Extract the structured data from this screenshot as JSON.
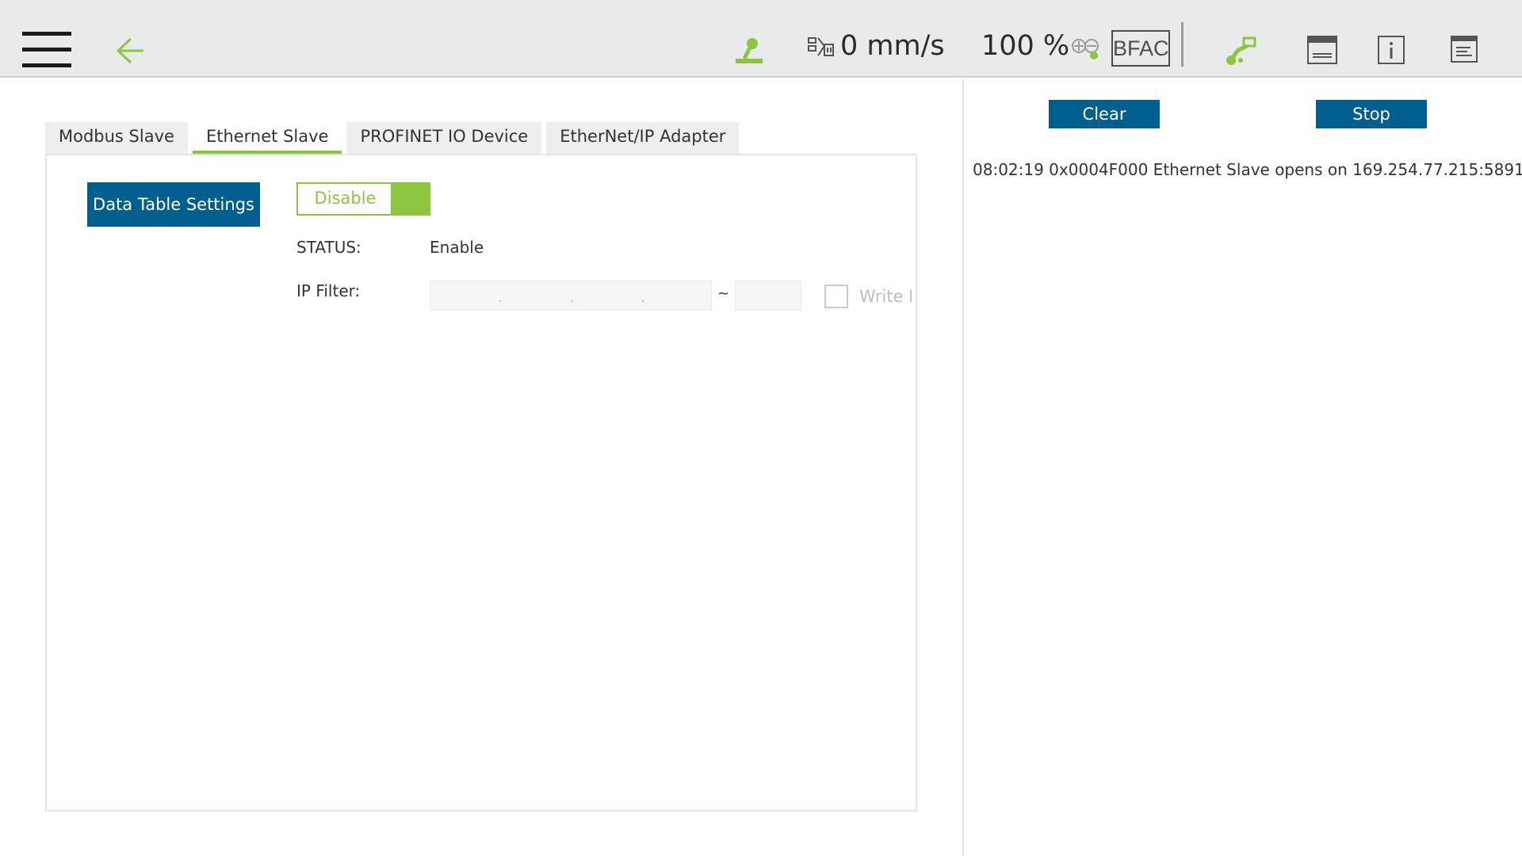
{
  "topbar": {
    "speed": "0 mm/s",
    "percent": "100 %",
    "mode_badge": "BFAC",
    "accent_color": "#8cc63f",
    "icons": [
      "menu-icon",
      "back-arrow-icon",
      "robot-arm-icon",
      "speed-icon",
      "eoat-icon",
      "robot-pose-icon",
      "keyboard-icon",
      "info-icon",
      "log-icon"
    ]
  },
  "tabs": [
    "Modbus Slave",
    "Ethernet Slave",
    "PROFINET IO Device",
    "EtherNet/IP Adapter"
  ],
  "active_tab": "Ethernet Slave",
  "settings": {
    "data_table_button": "Data Table Settings",
    "toggle_label": "Disable",
    "status_label": "STATUS:",
    "status_value": "Enable",
    "ip_filter_label": "IP Filter:",
    "tilde": "~",
    "write_label": "Write I"
  },
  "right_panel": {
    "clear_button": "Clear",
    "stop_button": "Stop",
    "log": [
      "08:02:19 0x0004F000 Ethernet Slave opens on 169.254.77.215:5891"
    ]
  }
}
